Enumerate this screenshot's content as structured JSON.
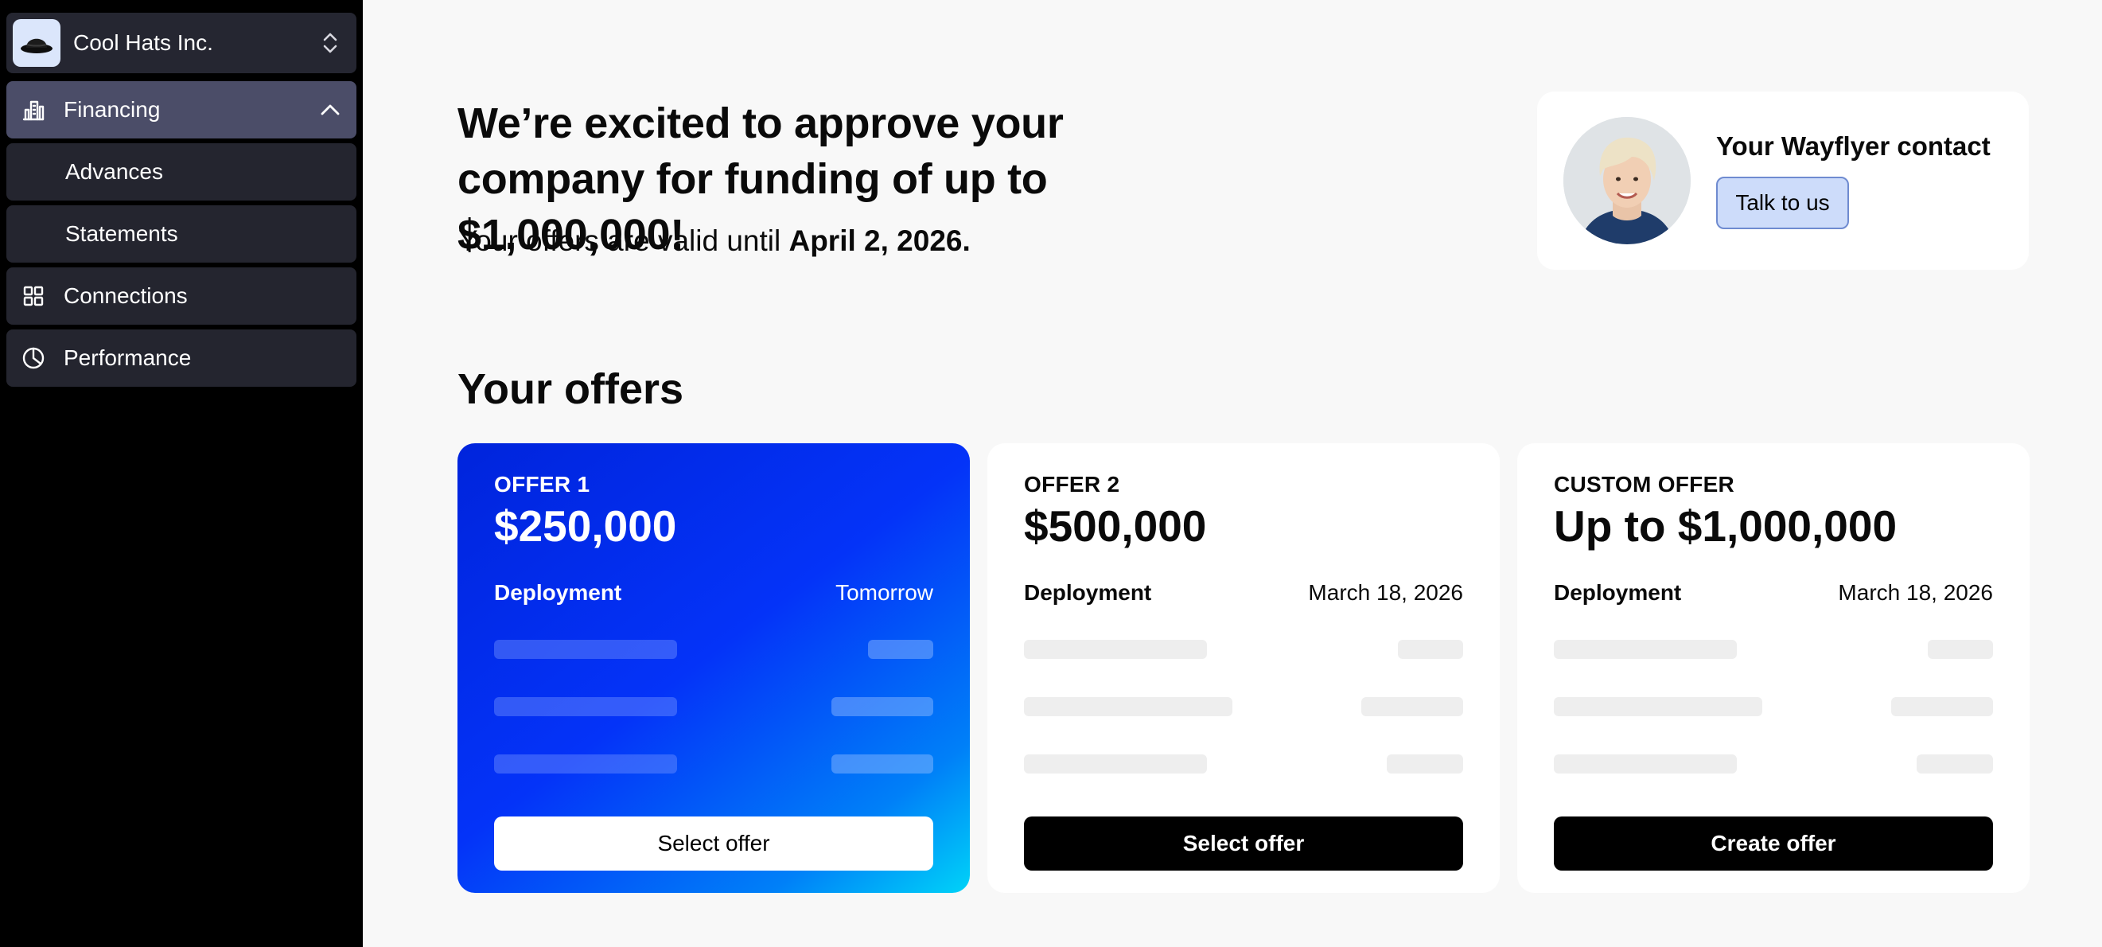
{
  "sidebar": {
    "company_name": "Cool Hats Inc.",
    "items": [
      {
        "label": "Financing",
        "icon": "building-chart-icon",
        "active": true,
        "expanded": true
      },
      {
        "label": "Advances"
      },
      {
        "label": "Statements"
      },
      {
        "label": "Connections",
        "icon": "grid-icon"
      },
      {
        "label": "Performance",
        "icon": "pie-chart-icon"
      }
    ]
  },
  "main": {
    "headline": "We’re excited to approve your company for funding of up to $1,000,000!",
    "validity_prefix": "Your offers are valid until ",
    "validity_date": "April 2, 2026.",
    "contact": {
      "title": "Your Wayflyer contact",
      "button_label": "Talk to us"
    },
    "offers_title": "Your offers",
    "offers": [
      {
        "tag": "OFFER 1",
        "amount": "$250,000",
        "deployment_label": "Deployment",
        "deployment_value": "Tomorrow",
        "button": "Select offer"
      },
      {
        "tag": "OFFER 2",
        "amount": "$500,000",
        "deployment_label": "Deployment",
        "deployment_value": "March 18, 2026",
        "button": "Select offer"
      },
      {
        "tag": "CUSTOM OFFER",
        "amount": "Up to $1,000,000",
        "deployment_label": "Deployment",
        "deployment_value": "March 18, 2026",
        "button": "Create offer"
      }
    ]
  },
  "colors": {
    "sidebar_bg": "#000000",
    "nav_item_bg": "#24252f",
    "nav_active_bg": "#4b4d68",
    "primary_gradient_start": "#0024dc",
    "primary_gradient_end": "#00d3f8",
    "talk_button_bg": "#cddcfa"
  }
}
